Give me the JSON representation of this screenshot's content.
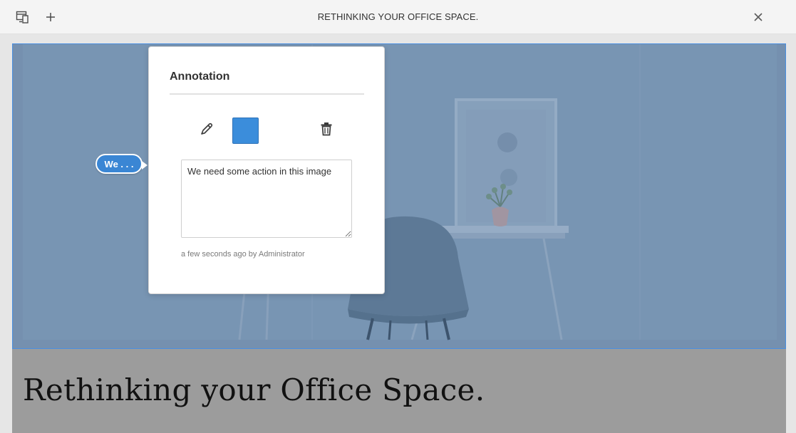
{
  "topbar": {
    "title": "RETHINKING YOUR OFFICE SPACE.",
    "left_icons": [
      "emulator-icon",
      "add-icon"
    ],
    "right_icons": [
      "close-icon"
    ]
  },
  "annotation_bubble": {
    "label": "We . . .",
    "color": "#3a86d4"
  },
  "annotation_popover": {
    "title": "Annotation",
    "tools": [
      "pen-icon",
      "color-swatch",
      "trash-icon"
    ],
    "swatch_color": "#3b8ddb",
    "note_text": "We need some action in this image",
    "meta": "a few seconds ago by Administrator"
  },
  "page": {
    "heading": "Rethinking your Office Space."
  },
  "colors": {
    "selection_border": "#4a8fe0",
    "canvas_background": "#9c9c9c"
  }
}
